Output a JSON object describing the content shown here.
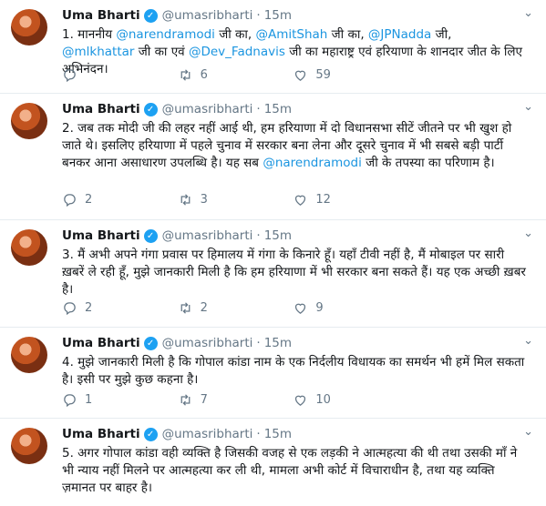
{
  "tweets": [
    {
      "name": "Uma Bharti",
      "handle": "@umasribharti",
      "time": "15m",
      "segments": [
        {
          "t": "1. माननीय "
        },
        {
          "t": "@narendramodi",
          "m": true
        },
        {
          "t": " जी का, "
        },
        {
          "t": "@AmitShah",
          "m": true
        },
        {
          "t": " जी का, "
        },
        {
          "t": "@JPNadda",
          "m": true
        },
        {
          "t": " जी, "
        },
        {
          "t": "@mlkhattar",
          "m": true
        },
        {
          "t": " जी का एवं "
        },
        {
          "t": "@Dev_Fadnavis",
          "m": true
        },
        {
          "t": " जी का महाराष्ट्र एवं हरियाणा के शानदार जीत के लिए अभिनंदन।"
        }
      ],
      "replies": "",
      "retweets": "6",
      "likes": "59"
    },
    {
      "name": "Uma Bharti",
      "handle": "@umasribharti",
      "time": "15m",
      "segments": [
        {
          "t": "2. जब तक मोदी जी की लहर नहीं आई थी, हम हरियाणा में दो विधानसभा सीटें जीतने पर भी खुश हो जाते थे। इसलिए हरियाणा में पहले चुनाव में सरकार बना लेना और दूसरे चुनाव में भी सबसे बड़ी पार्टी बनकर आना असाधारण उपलब्धि है। यह सब "
        },
        {
          "t": "@narendramodi",
          "m": true
        },
        {
          "t": " जी के तपस्या का परिणाम है।"
        }
      ],
      "replies": "2",
      "retweets": "3",
      "likes": "12"
    },
    {
      "name": "Uma Bharti",
      "handle": "@umasribharti",
      "time": "15m",
      "segments": [
        {
          "t": "3. मैं अभी अपने गंगा प्रवास पर हिमालय में गंगा के किनारे हूँ। यहाँ टीवी नहीं है, मैं मोबाइल पर सारी ख़बरें ले रही हूँ, मुझे जानकारी मिली है कि हम हरियाणा में भी सरकार बना सकते हैं। यह एक अच्छी ख़बर है।"
        }
      ],
      "replies": "2",
      "retweets": "2",
      "likes": "9"
    },
    {
      "name": "Uma Bharti",
      "handle": "@umasribharti",
      "time": "15m",
      "segments": [
        {
          "t": "4. मुझे जानकारी मिली है कि गोपाल कांडा नाम के एक निर्दलीय विधायक का समर्थन भी हमें मिल सकता है। इसी पर मुझे कुछ कहना है।"
        }
      ],
      "replies": "1",
      "retweets": "7",
      "likes": "10"
    },
    {
      "name": "Uma Bharti",
      "handle": "@umasribharti",
      "time": "15m",
      "segments": [
        {
          "t": "5. अगर गोपाल कांडा वही व्यक्ति है जिसकी वजह से एक लड़की ने आत्महत्या की थी तथा उसकी माँ ने भी न्याय नहीं मिलने पर आत्महत्या कर ली थी, मामला अभी कोर्ट में विचाराधीन है, तथा यह व्यक्ति ज़मानत पर बाहर है।"
        }
      ],
      "replies": "",
      "retweets": "",
      "likes": ""
    }
  ],
  "colors": {
    "mention": "#1b95e0",
    "verified": "#1da1f2",
    "secondary": "#657786",
    "divider": "#e6ecf0"
  },
  "icons": [
    "verified-icon",
    "chevron-down-icon",
    "reply-icon",
    "retweet-icon",
    "like-icon"
  ]
}
